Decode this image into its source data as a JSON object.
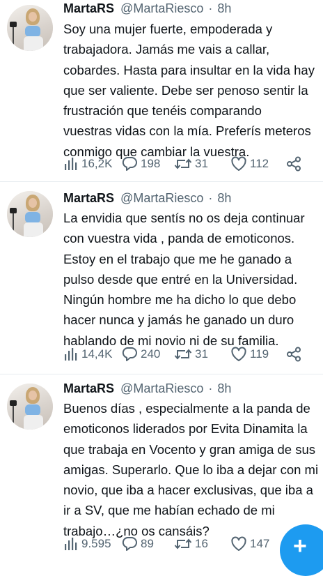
{
  "tweets": [
    {
      "name": "MartaRS",
      "handle": "@MartaRiesco",
      "separator": "·",
      "time": "8h",
      "lines": [
        "Soy una mujer fuerte, empoderada y",
        "trabajadora. Jamás me vais a callar,",
        "cobardes. Hasta para insultar en la vida hay",
        "que ser valiente. Debe ser penoso sentir la",
        "frustración que tenéis comparando",
        "vuestras vidas con la mía. Preferís meteros",
        "conmigo que cambiar la vuestra."
      ],
      "views": "16,2K",
      "replies": "198",
      "retweets": "31",
      "likes": "112"
    },
    {
      "name": "MartaRS",
      "handle": "@MartaRiesco",
      "separator": "·",
      "time": "8h",
      "lines": [
        "La envidia que sentís no os deja continuar",
        "con vuestra vida , panda de emoticonos.",
        "Estoy en el trabajo que me he ganado a",
        "pulso desde que entré en la Universidad.",
        "Ningún hombre me ha dicho lo que debo",
        "hacer nunca y jamás he ganado un duro",
        "hablando de mi novio ni de su familia."
      ],
      "views": "14,4K",
      "replies": "240",
      "retweets": "31",
      "likes": "119"
    },
    {
      "name": "MartaRS",
      "handle": "@MartaRiesco",
      "separator": "·",
      "time": "8h",
      "lines": [
        "Buenos días , especialmente a la panda de",
        "emoticonos liderados por Evita Dinamita la",
        "que trabaja en Vocento y gran amiga de sus",
        "amigas. Superarlo. Que lo iba a dejar con mi",
        "novio, que iba a hacer exclusivas, que iba a",
        "ir a SV, que me habían echado de mi",
        "trabajo…¿no os cansáis?"
      ],
      "views": "9.595",
      "replies": "89",
      "retweets": "16",
      "likes": "147"
    }
  ],
  "compose_button": {
    "symbol": "+",
    "icon": "plus-icon"
  },
  "colors": {
    "accent": "#1d9bf0",
    "text": "#0f1419",
    "secondary": "#536471",
    "divider": "#e6ecf0"
  }
}
